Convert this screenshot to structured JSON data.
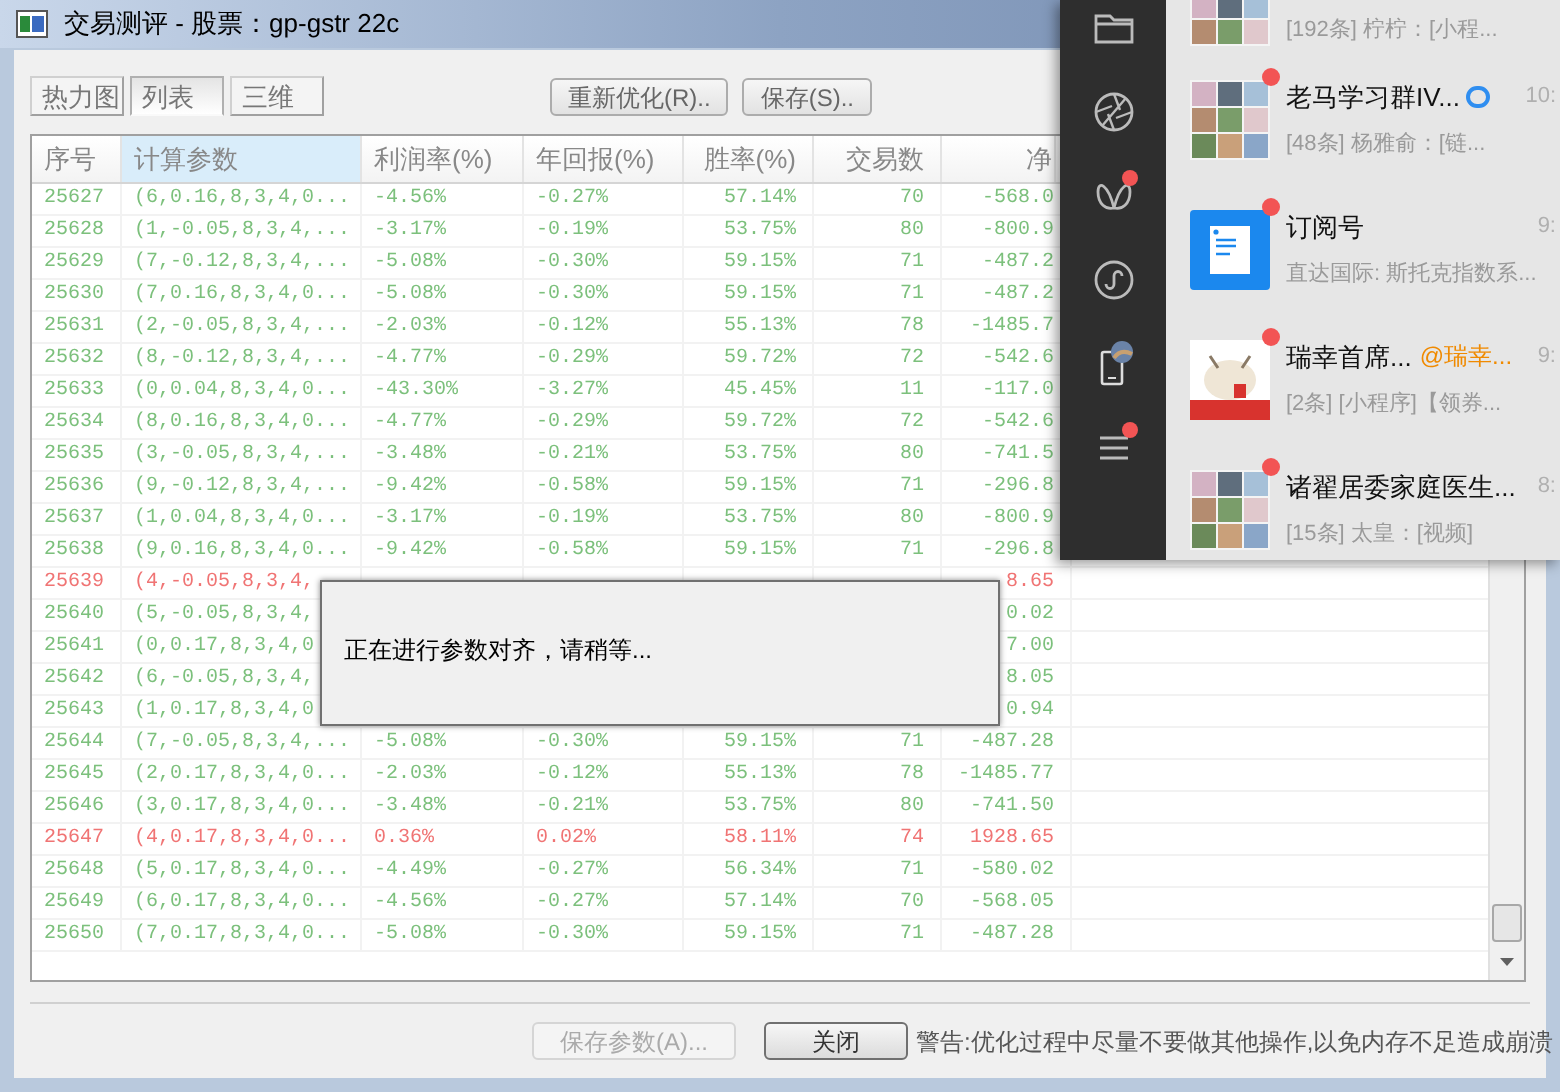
{
  "window": {
    "title": "交易测评 - 股票：gp-gstr 22c"
  },
  "view_tabs": [
    {
      "label": "热力图",
      "selected": false
    },
    {
      "label": "列表",
      "selected": true
    },
    {
      "label": "三维",
      "selected": false
    }
  ],
  "toolbar_buttons": [
    "重新优化(R)..",
    "保存(S).."
  ],
  "table": {
    "columns": [
      {
        "label": "序号",
        "selected": false
      },
      {
        "label": "计算参数",
        "selected": true
      },
      {
        "label": "利润率(%)",
        "selected": false
      },
      {
        "label": "年回报(%)",
        "selected": false
      },
      {
        "label": "胜率(%)",
        "selected": false
      },
      {
        "label": "交易数",
        "selected": false
      },
      {
        "label": "净",
        "selected": false
      }
    ],
    "rows": [
      {
        "positive": false,
        "cells": [
          "25627",
          "(6,0.16,8,3,4,0...",
          "-4.56%",
          "-0.27%",
          "57.14%",
          "70",
          "-568.0"
        ]
      },
      {
        "positive": false,
        "cells": [
          "25628",
          "(1,-0.05,8,3,4,...",
          "-3.17%",
          "-0.19%",
          "53.75%",
          "80",
          "-800.9"
        ]
      },
      {
        "positive": false,
        "cells": [
          "25629",
          "(7,-0.12,8,3,4,...",
          "-5.08%",
          "-0.30%",
          "59.15%",
          "71",
          "-487.2"
        ]
      },
      {
        "positive": false,
        "cells": [
          "25630",
          "(7,0.16,8,3,4,0...",
          "-5.08%",
          "-0.30%",
          "59.15%",
          "71",
          "-487.2"
        ]
      },
      {
        "positive": false,
        "cells": [
          "25631",
          "(2,-0.05,8,3,4,...",
          "-2.03%",
          "-0.12%",
          "55.13%",
          "78",
          "-1485.7"
        ]
      },
      {
        "positive": false,
        "cells": [
          "25632",
          "(8,-0.12,8,3,4,...",
          "-4.77%",
          "-0.29%",
          "59.72%",
          "72",
          "-542.6"
        ]
      },
      {
        "positive": false,
        "cells": [
          "25633",
          "(0,0.04,8,3,4,0...",
          "-43.30%",
          "-3.27%",
          "45.45%",
          "11",
          "-117.0"
        ]
      },
      {
        "positive": false,
        "cells": [
          "25634",
          "(8,0.16,8,3,4,0...",
          "-4.77%",
          "-0.29%",
          "59.72%",
          "72",
          "-542.6"
        ]
      },
      {
        "positive": false,
        "cells": [
          "25635",
          "(3,-0.05,8,3,4,...",
          "-3.48%",
          "-0.21%",
          "53.75%",
          "80",
          "-741.5"
        ]
      },
      {
        "positive": false,
        "cells": [
          "25636",
          "(9,-0.12,8,3,4,...",
          "-9.42%",
          "-0.58%",
          "59.15%",
          "71",
          "-296.8"
        ]
      },
      {
        "positive": false,
        "cells": [
          "25637",
          "(1,0.04,8,3,4,0...",
          "-3.17%",
          "-0.19%",
          "53.75%",
          "80",
          "-800.9"
        ]
      },
      {
        "positive": false,
        "cells": [
          "25638",
          "(9,0.16,8,3,4,0...",
          "-9.42%",
          "-0.58%",
          "59.15%",
          "71",
          "-296.8"
        ]
      },
      {
        "positive": true,
        "cells": [
          "25639",
          "(4,-0.05,8,3,4,",
          null,
          null,
          null,
          null,
          "8.65"
        ]
      },
      {
        "positive": false,
        "cells": [
          "25640",
          "(5,-0.05,8,3,4,",
          null,
          null,
          null,
          null,
          "0.02"
        ]
      },
      {
        "positive": false,
        "cells": [
          "25641",
          "(0,0.17,8,3,4,0",
          null,
          null,
          null,
          null,
          "7.00"
        ]
      },
      {
        "positive": false,
        "cells": [
          "25642",
          "(6,-0.05,8,3,4,",
          null,
          null,
          null,
          null,
          "8.05"
        ]
      },
      {
        "positive": false,
        "cells": [
          "25643",
          "(1,0.17,8,3,4,0",
          null,
          null,
          null,
          null,
          "0.94"
        ]
      },
      {
        "positive": false,
        "cells": [
          "25644",
          "(7,-0.05,8,3,4,...",
          "-5.08%",
          "-0.30%",
          "59.15%",
          "71",
          "-487.28"
        ]
      },
      {
        "positive": false,
        "cells": [
          "25645",
          "(2,0.17,8,3,4,0...",
          "-2.03%",
          "-0.12%",
          "55.13%",
          "78",
          "-1485.77"
        ]
      },
      {
        "positive": false,
        "cells": [
          "25646",
          "(3,0.17,8,3,4,0...",
          "-3.48%",
          "-0.21%",
          "53.75%",
          "80",
          "-741.50"
        ]
      },
      {
        "positive": true,
        "cells": [
          "25647",
          "(4,0.17,8,3,4,0...",
          "0.36%",
          "0.02%",
          "58.11%",
          "74",
          "1928.65"
        ]
      },
      {
        "positive": false,
        "cells": [
          "25648",
          "(5,0.17,8,3,4,0...",
          "-4.49%",
          "-0.27%",
          "56.34%",
          "71",
          "-580.02"
        ]
      },
      {
        "positive": false,
        "cells": [
          "25649",
          "(6,0.17,8,3,4,0...",
          "-4.56%",
          "-0.27%",
          "57.14%",
          "70",
          "-568.05"
        ]
      },
      {
        "positive": false,
        "cells": [
          "25650",
          "(7,0.17,8,3,4,0...",
          "-5.08%",
          "-0.30%",
          "59.15%",
          "71",
          "-487.28"
        ]
      }
    ]
  },
  "dialog": {
    "message": "正在进行参数对齐，请稍等..."
  },
  "bottom_buttons": [
    {
      "label": "保存参数(A)...",
      "disabled": true
    },
    {
      "label": "关闭",
      "disabled": false
    }
  ],
  "warning": "警告:优化过程中尽量不要做其他操作,以免内存不足造成崩溃",
  "chat_panel": {
    "sidebar": [
      {
        "kind": "folder",
        "badge": false
      },
      {
        "kind": "aperture",
        "badge": false
      },
      {
        "kind": "butterfly",
        "badge": true
      },
      {
        "kind": "miniprogram",
        "badge": false
      },
      {
        "kind": "phone",
        "badge": false
      },
      {
        "kind": "menu",
        "badge": true
      }
    ],
    "chats": [
      {
        "kind": "group",
        "unread": false,
        "preview": "[192条] 柠柠：[小程..."
      },
      {
        "kind": "group",
        "unread": true,
        "name": "老马学习群IV...",
        "time": "10:",
        "preview": "[48条] 杨雅俞：[链..."
      },
      {
        "kind": "doc",
        "unread": true,
        "name": "订阅号",
        "time": "9:",
        "preview": "直达国际: 斯托克指数系..."
      },
      {
        "kind": "picture",
        "unread": true,
        "name": "瑞幸首席...",
        "mention": "@瑞幸...",
        "time": "9:",
        "preview": "[2条] [小程序]【领券..."
      },
      {
        "kind": "group",
        "unread": true,
        "name": "诸翟居委家庭医生...",
        "time": "8:",
        "preview": "[15条] 太皇：[视频]"
      }
    ]
  }
}
